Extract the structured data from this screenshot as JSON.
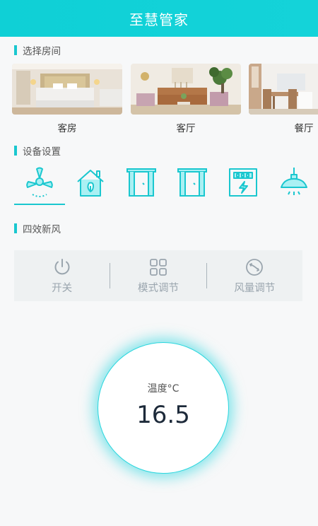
{
  "app": {
    "title": "至慧管家"
  },
  "sections": {
    "rooms_title": "选择房间",
    "devices_title": "设备设置",
    "device_detail_title": "四效新风"
  },
  "rooms": [
    {
      "label": "客房",
      "selected": false
    },
    {
      "label": "客厅",
      "selected": true
    },
    {
      "label": "餐厅",
      "selected": false
    }
  ],
  "devices": [
    {
      "icon": "ceiling-fan-icon",
      "selected": true
    },
    {
      "icon": "smart-home-icon",
      "selected": false
    },
    {
      "icon": "curtain-icon",
      "selected": false
    },
    {
      "icon": "curtain-icon",
      "selected": false
    },
    {
      "icon": "power-panel-icon",
      "selected": false
    },
    {
      "icon": "pendant-lamp-icon",
      "selected": false
    }
  ],
  "controls": {
    "power_label": "开关",
    "mode_label": "模式调节",
    "wind_label": "风量调节"
  },
  "temperature": {
    "label": "温度°C",
    "value": "16.5"
  },
  "colors": {
    "accent": "#1ac7cf",
    "header": "#12d1d7",
    "control_text": "#9aa5ae"
  }
}
